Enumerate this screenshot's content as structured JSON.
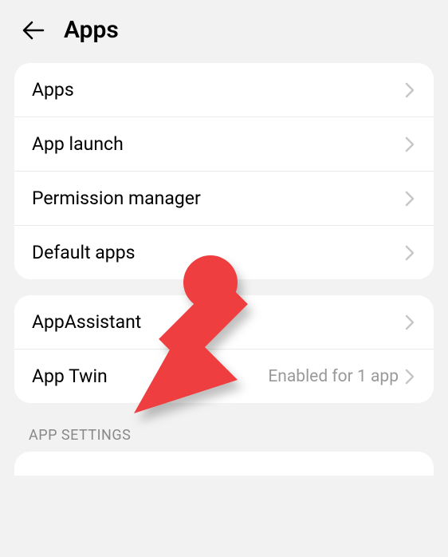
{
  "header": {
    "title": "Apps"
  },
  "section1": {
    "items": [
      {
        "label": "Apps"
      },
      {
        "label": "App launch"
      },
      {
        "label": "Permission manager"
      },
      {
        "label": "Default apps"
      }
    ]
  },
  "section2": {
    "items": [
      {
        "label": "AppAssistant"
      },
      {
        "label": "App Twin",
        "value": "Enabled for 1 app"
      }
    ]
  },
  "section3": {
    "header": "APP SETTINGS"
  },
  "annotation": {
    "color": "#ee3e3f"
  }
}
